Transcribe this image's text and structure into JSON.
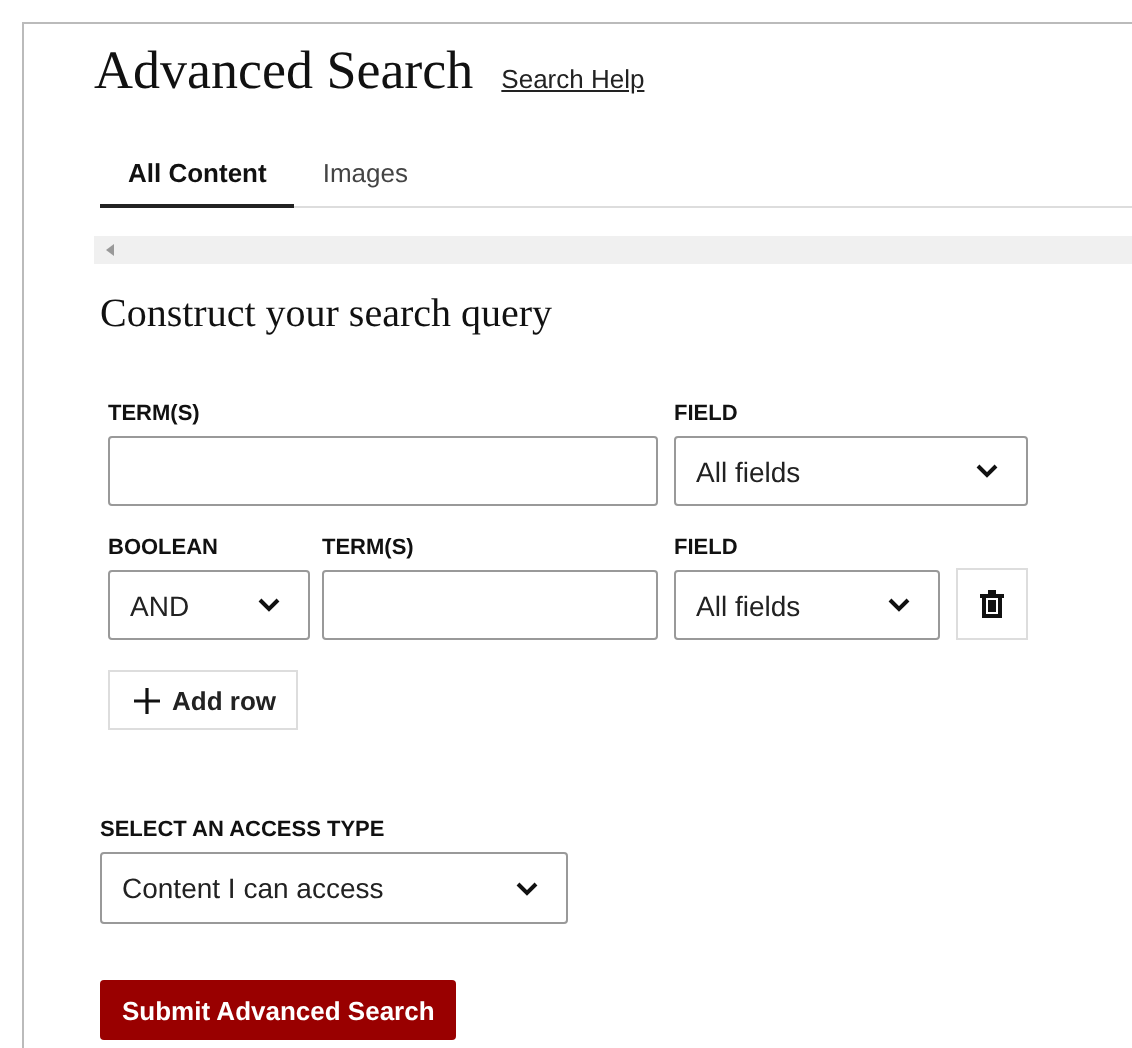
{
  "page": {
    "title": "Advanced Search",
    "help_link": "Search Help"
  },
  "tabs": [
    {
      "label": "All Content",
      "selected": true
    },
    {
      "label": "Images",
      "selected": false
    }
  ],
  "query": {
    "heading": "Construct your search query",
    "rows": [
      {
        "kind": "first",
        "term_label": "TERM(S)",
        "field_label": "FIELD",
        "field_value": "All fields"
      },
      {
        "kind": "additional",
        "boolean_label": "BOOLEAN",
        "boolean_value": "AND",
        "term_label": "TERM(S)",
        "field_label": "FIELD",
        "field_value": "All fields"
      }
    ],
    "add_row": "Add row"
  },
  "access": {
    "label": "SELECT AN ACCESS TYPE",
    "value": "Content I can access"
  },
  "submit": "Submit Advanced Search"
}
